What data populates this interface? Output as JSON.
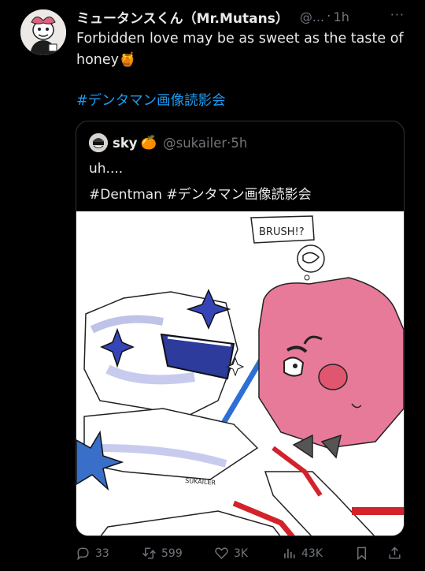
{
  "tweet": {
    "display_name": "ミュータンスくん（Mr.Mutans）",
    "handle": "@...",
    "dot": "·",
    "time": "1h",
    "more": "···",
    "text": "Forbidden love may be as sweet as the taste of honey🍯",
    "hashtag": "#デンタマン画像読影会"
  },
  "quote": {
    "name": "sky",
    "emoji": "🍊",
    "handle": "@sukailer",
    "dot": "·",
    "time": "5h",
    "line1": "uh....",
    "line2": "#Dentman #デンタマン画像読影会",
    "image_caption_speech": "BRUSH!?",
    "image_signature": "SUKAILER"
  },
  "actions": {
    "replies": "33",
    "retweets": "599",
    "likes": "3K",
    "views": "43K"
  },
  "colors": {
    "background": "#000000",
    "text": "#e7e9ea",
    "muted": "#71767b",
    "link": "#1d9bf0",
    "border": "#2f3336"
  },
  "icons": [
    "reply-icon",
    "retweet-icon",
    "like-icon",
    "views-icon",
    "bookmark-icon",
    "share-icon"
  ]
}
